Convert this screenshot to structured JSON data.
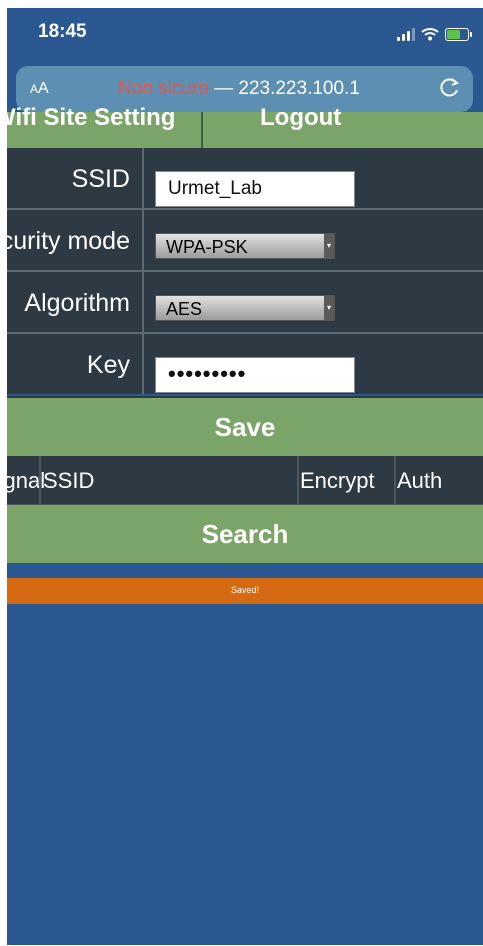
{
  "status_bar": {
    "time": "18:45",
    "battery_color": "#5ec24a"
  },
  "address_bar": {
    "aa_label_small": "A",
    "aa_label_big": "A",
    "security_text": "Non sicuro",
    "separator": " — ",
    "host": "223.223.100.1",
    "reload_icon": "reload-icon"
  },
  "header_tabs": {
    "left_label": "Wifi Site Setting",
    "right_label": "Logout"
  },
  "form": {
    "ssid_label": "SSID",
    "ssid_value": "Urmet_Lab",
    "security_label": "Security mode",
    "security_value": "WPA-PSK",
    "algorithm_label": "Algorithm",
    "algorithm_value": "AES",
    "key_label": "Key",
    "key_value": "•••••••••"
  },
  "save_button": "Save",
  "results_table": {
    "columns": [
      "Signal",
      "SSID",
      "Encrypt",
      "Auth"
    ]
  },
  "search_button": "Search",
  "status_message": "Saved!",
  "colors": {
    "page_blue": "#2b5890",
    "button_green": "#7aa468",
    "form_dark": "#2d3943",
    "status_orange": "#d56a12",
    "insecure_red": "#e05850"
  }
}
